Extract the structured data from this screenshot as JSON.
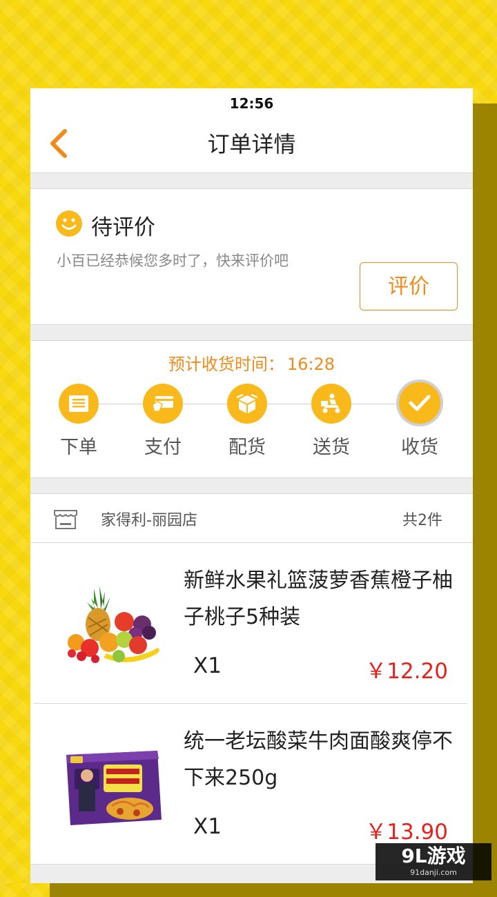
{
  "status_bar": {
    "time": "12:56"
  },
  "nav": {
    "title": "订单详情",
    "back_icon": "chevron-left-icon"
  },
  "order_status": {
    "title": "待评价",
    "subtitle": "小百已经恭候您多时了，快来评价吧",
    "action_label": "评价"
  },
  "delivery": {
    "eta_label": "预计收货时间：",
    "eta_time": "16:28",
    "steps": [
      {
        "label": "下单",
        "icon": "receipt-icon"
      },
      {
        "label": "支付",
        "icon": "card-icon"
      },
      {
        "label": "配货",
        "icon": "package-icon"
      },
      {
        "label": "送货",
        "icon": "delivery-scooter-icon"
      },
      {
        "label": "收货",
        "icon": "checkmark-icon",
        "done": true
      }
    ]
  },
  "store": {
    "name": "家得利-丽园店",
    "count": "共2件",
    "icon": "store-icon"
  },
  "products": [
    {
      "name": "新鲜水果礼篮菠萝香蕉橙子柚子桃子5种装",
      "qty": "X1",
      "price": "￥12.20",
      "image": "fruit-basket"
    },
    {
      "name": "统一老坛酸菜牛肉面酸爽停不下来250g",
      "qty": "X1",
      "price": "￥13.90",
      "image": "instant-noodles"
    }
  ],
  "watermark": {
    "logo": "9L游戏",
    "url": "91danji.com"
  },
  "colors": {
    "accent": "#f08a1a",
    "step": "#f9b91a",
    "price": "#e6211c",
    "background": "#f8d90f"
  }
}
